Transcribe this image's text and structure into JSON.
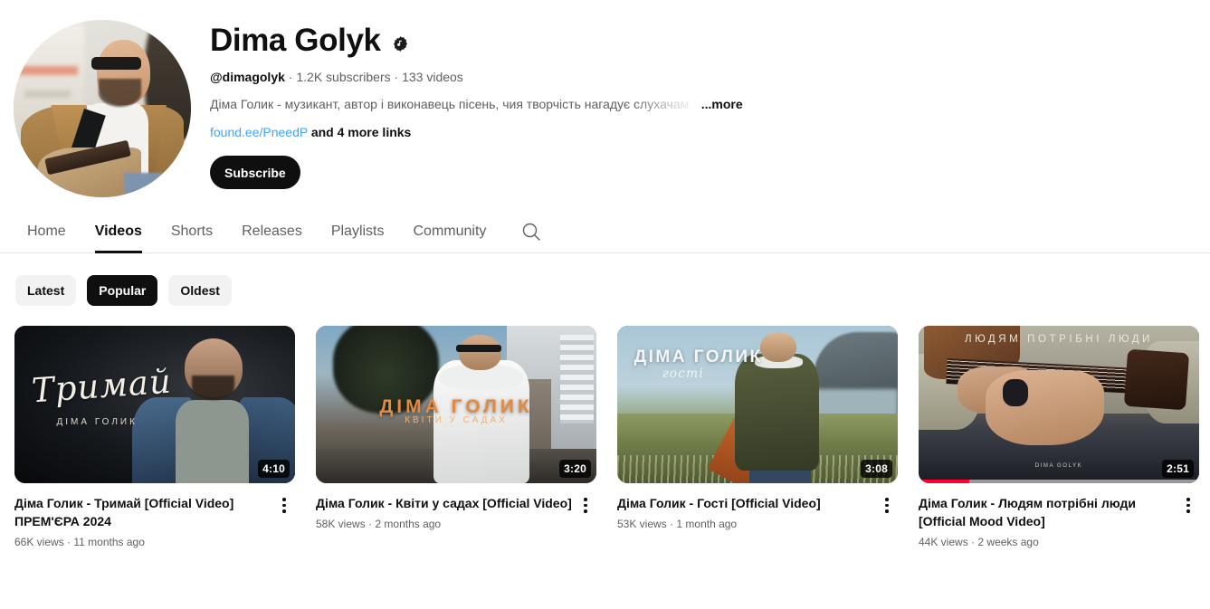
{
  "channel": {
    "name": "Dima Golyk",
    "badge_icon": "music-verified-badge-icon",
    "handle": "@dimagolyk",
    "subscribers": "1.2K subscribers",
    "video_count": "133 videos",
    "meta_separator": "·",
    "description": "Діма Голик - музикант, автор і виконавець пісень, чия творчість нагадує слухачам п",
    "more_label": "...more",
    "primary_link": "found.ee/PneedP",
    "more_links_label": "and 4 more links",
    "subscribe_label": "Subscribe",
    "avatar_alt": "Dima Golyk playing guitar"
  },
  "tabs": [
    {
      "label": "Home",
      "active": false
    },
    {
      "label": "Videos",
      "active": true
    },
    {
      "label": "Shorts",
      "active": false
    },
    {
      "label": "Releases",
      "active": false
    },
    {
      "label": "Playlists",
      "active": false
    },
    {
      "label": "Community",
      "active": false
    }
  ],
  "search_icon": "search-icon",
  "chips": [
    {
      "label": "Latest",
      "selected": false
    },
    {
      "label": "Popular",
      "selected": true
    },
    {
      "label": "Oldest",
      "selected": false
    }
  ],
  "videos": [
    {
      "title": "Діма Голик - Тримай [Official Video] ПРЕМ'ЄРА 2024",
      "views": "66K views",
      "age": "11 months ago",
      "duration": "4:10",
      "progress_percent": 0,
      "thumb_title": "Тримай",
      "thumb_subtitle": "ДІМА ГОЛИК"
    },
    {
      "title": "Діма Голик - Квіти у садах [Official Video]",
      "views": "58K views",
      "age": "2 months ago",
      "duration": "3:20",
      "progress_percent": 0,
      "thumb_title": "ДІМА ГОЛИК",
      "thumb_subtitle": "КВІТИ У САДАХ"
    },
    {
      "title": "Діма Голик - Гості [Official Video]",
      "views": "53K views",
      "age": "1 month ago",
      "duration": "3:08",
      "progress_percent": 0,
      "thumb_title": "ДІМА ГОЛИК",
      "thumb_subtitle": "гості"
    },
    {
      "title": "Діма Голик - Людям потрібні люди [Official Mood Video]",
      "views": "44K views",
      "age": "2 weeks ago",
      "duration": "2:51",
      "progress_percent": 18,
      "thumb_title": "ЛЮДЯМ ПОТРІБНІ ЛЮДИ",
      "thumb_subtitle": "DIMA GOLYK"
    }
  ],
  "stats_separator": "·",
  "colors": {
    "link_blue": "#3ea6ff",
    "text_primary": "#0f0f0f",
    "text_secondary": "#606060",
    "chip_bg": "#f2f2f2",
    "progress_red": "#ff0033"
  }
}
